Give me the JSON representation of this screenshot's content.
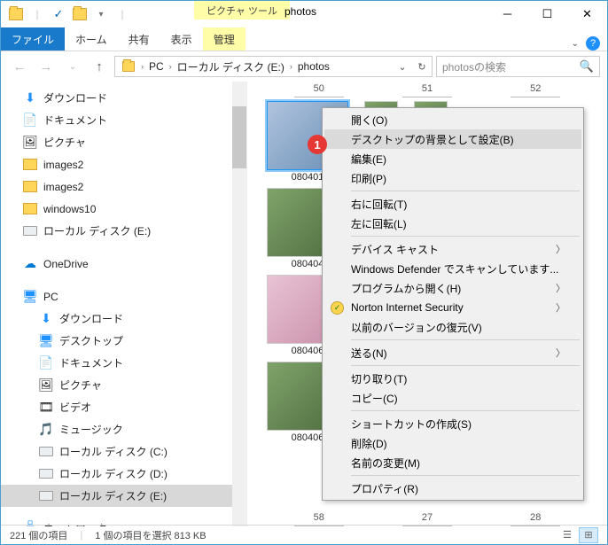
{
  "window": {
    "title": "photos",
    "contextual_tab": "ピクチャ ツール"
  },
  "ribbon": {
    "file": "ファイル",
    "home": "ホーム",
    "share": "共有",
    "view": "表示",
    "manage": "管理"
  },
  "address": {
    "segments": [
      "PC",
      "ローカル ディスク (E:)",
      "photos"
    ],
    "search_placeholder": "photosの検索"
  },
  "nav": {
    "items": [
      {
        "label": "ダウンロード",
        "icon": "dl",
        "lvl": 1
      },
      {
        "label": "ドキュメント",
        "icon": "doc",
        "lvl": 1
      },
      {
        "label": "ピクチャ",
        "icon": "pic",
        "lvl": 1
      },
      {
        "label": "images2",
        "icon": "folder",
        "lvl": 1
      },
      {
        "label": "images2",
        "icon": "folder",
        "lvl": 1
      },
      {
        "label": "windows10",
        "icon": "folder",
        "lvl": 1
      },
      {
        "label": "ローカル ディスク (E:)",
        "icon": "drive",
        "lvl": 1
      },
      {
        "label": "",
        "icon": "",
        "lvl": 1
      },
      {
        "label": "OneDrive",
        "icon": "onedrive",
        "lvl": 1
      },
      {
        "label": "",
        "icon": "",
        "lvl": 1
      },
      {
        "label": "PC",
        "icon": "pc",
        "lvl": 1
      },
      {
        "label": "ダウンロード",
        "icon": "dl",
        "lvl": 2
      },
      {
        "label": "デスクトップ",
        "icon": "desktop",
        "lvl": 2
      },
      {
        "label": "ドキュメント",
        "icon": "doc",
        "lvl": 2
      },
      {
        "label": "ピクチャ",
        "icon": "pic",
        "lvl": 2
      },
      {
        "label": "ビデオ",
        "icon": "video",
        "lvl": 2
      },
      {
        "label": "ミュージック",
        "icon": "music",
        "lvl": 2
      },
      {
        "label": "ローカル ディスク (C:)",
        "icon": "drive",
        "lvl": 2
      },
      {
        "label": "ローカル ディスク (D:)",
        "icon": "drive",
        "lvl": 2
      },
      {
        "label": "ローカル ディスク (E:)",
        "icon": "drive",
        "lvl": 2,
        "selected": true
      },
      {
        "label": "",
        "icon": "",
        "lvl": 1
      },
      {
        "label": "ネットワーク",
        "icon": "network",
        "lvl": 1
      }
    ]
  },
  "ruler": [
    "50",
    "51",
    "52"
  ],
  "thumbs": [
    {
      "label": "080401",
      "selected": true
    },
    {
      "label": "080404"
    },
    {
      "label": "080406",
      "pink": true
    },
    {
      "label": "080406"
    }
  ],
  "bottom_ruler": [
    "58",
    "27",
    "28"
  ],
  "context_menu": [
    {
      "type": "item",
      "label": "開く(O)"
    },
    {
      "type": "item",
      "label": "デスクトップの背景として設定(B)",
      "highlight": true
    },
    {
      "type": "item",
      "label": "編集(E)"
    },
    {
      "type": "item",
      "label": "印刷(P)"
    },
    {
      "type": "sep"
    },
    {
      "type": "item",
      "label": "右に回転(T)"
    },
    {
      "type": "item",
      "label": "左に回転(L)"
    },
    {
      "type": "sep"
    },
    {
      "type": "item",
      "label": "デバイス キャスト",
      "submenu": true
    },
    {
      "type": "item",
      "label": "Windows Defender でスキャンしています..."
    },
    {
      "type": "item",
      "label": "プログラムから開く(H)",
      "submenu": true
    },
    {
      "type": "item",
      "label": "Norton Internet Security",
      "submenu": true,
      "shield": true
    },
    {
      "type": "item",
      "label": "以前のバージョンの復元(V)"
    },
    {
      "type": "sep"
    },
    {
      "type": "item",
      "label": "送る(N)",
      "submenu": true
    },
    {
      "type": "sep"
    },
    {
      "type": "item",
      "label": "切り取り(T)"
    },
    {
      "type": "item",
      "label": "コピー(C)"
    },
    {
      "type": "sep"
    },
    {
      "type": "item",
      "label": "ショートカットの作成(S)"
    },
    {
      "type": "item",
      "label": "削除(D)"
    },
    {
      "type": "item",
      "label": "名前の変更(M)"
    },
    {
      "type": "sep"
    },
    {
      "type": "item",
      "label": "プロパティ(R)"
    }
  ],
  "badge": "1",
  "status": {
    "count": "221 個の項目",
    "selection": "1 個の項目を選択 813 KB"
  }
}
